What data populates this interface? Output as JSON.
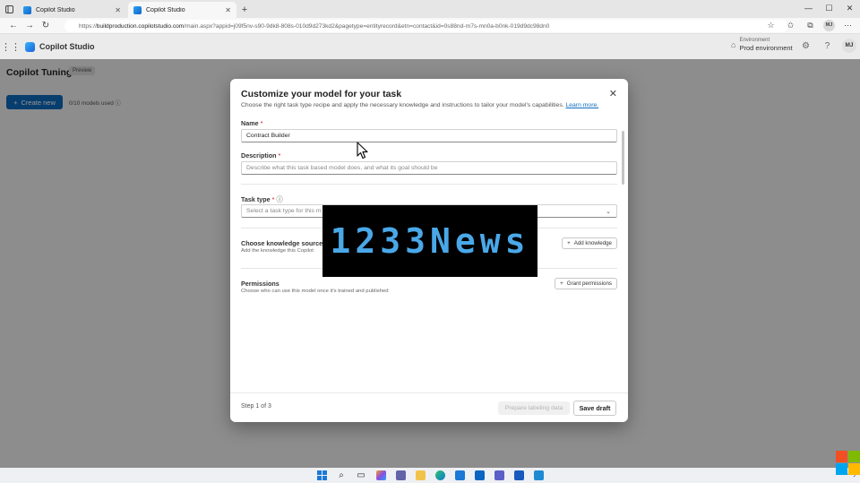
{
  "browser": {
    "tabs": [
      {
        "title": "Copilot Studio",
        "active": false
      },
      {
        "title": "Copilot Studio",
        "active": true
      }
    ],
    "url_prefix": "https://",
    "url_host": "buildproduction.copilotstudio.com",
    "url_path": "/main.aspx?appid=j09f5nv-s90-9dk8-808s-010d9d273kd2&pagetype=entityrecord&etn=contact&id=0s88nd-rn7s-mn0a-b0nk-019d9dc98dn0",
    "profile_initials": "MJ"
  },
  "app": {
    "brand": "Copilot Studio",
    "environment_label": "Environment",
    "environment_value": "Prod environment",
    "user_initials": "MJ"
  },
  "page": {
    "title": "Copilot Tuning",
    "badge": "Preview",
    "create_button": "Create new",
    "models_used": "0/10 models used"
  },
  "modal": {
    "title": "Customize your model for your task",
    "subtitle": "Choose the right task type recipe and apply the necessary knowledge and instructions to tailor your model's capabilities.",
    "learn_more": "Learn more.",
    "name_label": "Name",
    "name_value": "Contract Builder",
    "description_label": "Description",
    "description_placeholder": "Describe what this task based model does, and what its goal should be",
    "task_type_label": "Task type",
    "task_type_placeholder": "Select a task type for this m",
    "knowledge_title": "Choose knowledge sources",
    "knowledge_desc": "Add the knowledge this Copilot",
    "add_knowledge": "Add knowledge",
    "permissions_title": "Permissions",
    "permissions_desc": "Choose who can use this model once it's trained and published",
    "grant_permissions": "Grant permissions",
    "step": "Step 1 of 3",
    "prepare_button": "Prepare labeling data",
    "save_button": "Save draft",
    "required_mark": "*"
  },
  "watermark": "1233News",
  "colors": {
    "accent": "#0f6cbd",
    "required": "#c50f1f",
    "watermark_text": "#4aa8e8"
  }
}
